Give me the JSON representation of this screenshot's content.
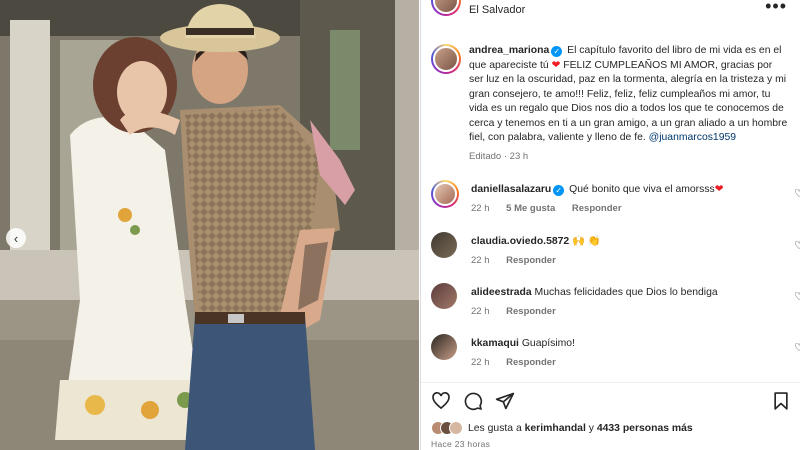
{
  "post": {
    "location": "El Salvador",
    "more_label": "•••",
    "prev_label": "‹"
  },
  "caption": {
    "username": "andrea_mariona",
    "text_1": "El capítulo favorito del libro de mi vida es en el que apareciste tú",
    "text_2": "FELIZ CUMPLEAÑOS MI AMOR, gracias por ser luz en la oscuridad, paz en la tormenta, alegría en la tristeza y mi gran consejero, te amo!!! Feliz, feliz, feliz cumpleaños mi amor, tu vida es un regalo que Dios nos dio a todos los que te conocemos de cerca y tenemos en ti a un gran amigo, a un gran aliado a un hombre fiel, con palabra, valiente y lleno de fe.",
    "mention": "@juanmarcos1959",
    "meta": "Editado · 23 h"
  },
  "comments": [
    {
      "username": "daniellasalazaru",
      "verified": true,
      "text": "Qué bonito que viva el amorsss",
      "heart": true,
      "time": "22 h",
      "likes": "5 Me gusta",
      "reply": "Responder"
    },
    {
      "username": "claudia.oviedo.5872",
      "verified": false,
      "text": "🙌 👏",
      "heart": false,
      "time": "22 h",
      "likes": "",
      "reply": "Responder"
    },
    {
      "username": "alideestrada",
      "verified": false,
      "text": "Muchas felicidades que Dios lo bendiga",
      "heart": false,
      "time": "22 h",
      "likes": "",
      "reply": "Responder"
    },
    {
      "username": "kkamaqui",
      "verified": false,
      "text": "Guapísimo!",
      "heart": false,
      "time": "22 h",
      "likes": "",
      "reply": "Responder"
    }
  ],
  "actions": {
    "likes_prefix": "Les gusta a",
    "likes_user": "kerimhandal",
    "likes_connector": "y",
    "likes_count": "4433 personas más",
    "time_ago": "Hace 23 horas"
  },
  "icons": [
    "heart-icon",
    "comment-icon",
    "share-icon",
    "save-icon",
    "verified-icon",
    "chevron-left-icon",
    "more-icon"
  ],
  "colors": {
    "link": "#00376b",
    "verified": "#0095f6",
    "heart": "#ed1c24",
    "muted": "#737373"
  }
}
